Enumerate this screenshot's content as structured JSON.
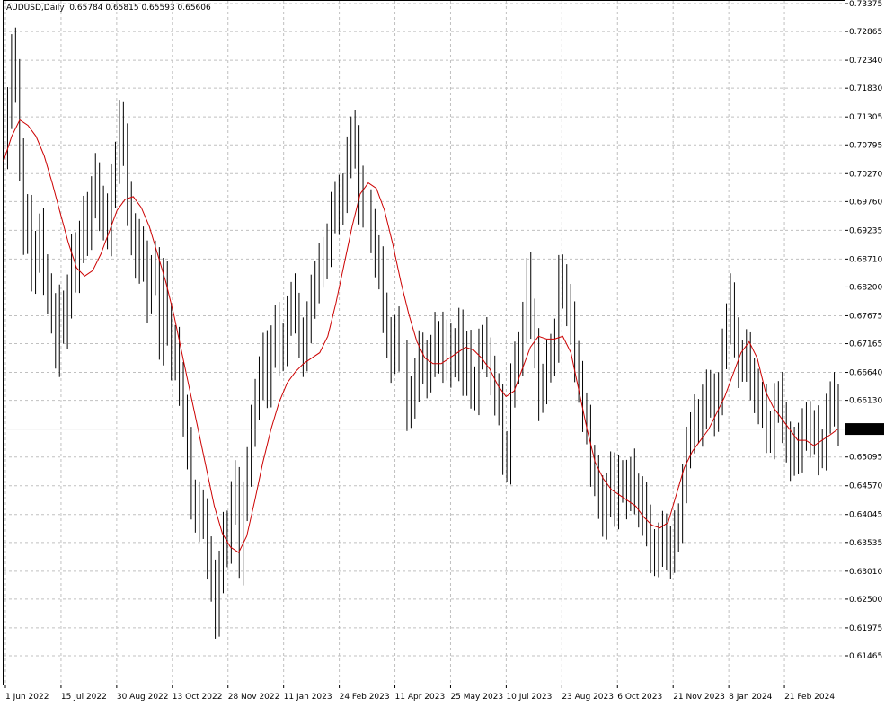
{
  "header": {
    "symbol": "AUDUSD,Daily",
    "ohlc": "0.65784 0.65815 0.65593 0.65606"
  },
  "colors": {
    "background": "#ffffff",
    "bars": "#000000",
    "moving_average": "#cc0000",
    "grid": "#c0c0c0",
    "current_price_line": "#c0c0c0",
    "price_tag_bg": "#000000",
    "price_tag_text": "#ffffff"
  },
  "chart_data": {
    "type": "line",
    "grid": true,
    "ylim": [
      0.61465,
      0.73375
    ],
    "y_ticks": [
      "0.73375",
      "0.72865",
      "0.72340",
      "0.71830",
      "0.71305",
      "0.70795",
      "0.70270",
      "0.69760",
      "0.69235",
      "0.68710",
      "0.68200",
      "0.67675",
      "0.67165",
      "0.66640",
      "0.66130",
      "0.65095",
      "0.64570",
      "0.64045",
      "0.63535",
      "0.63010",
      "0.62500",
      "0.61975",
      "0.61465"
    ],
    "x_ticks": [
      "1 Jun 2022",
      "15 Jul 2022",
      "30 Aug 2022",
      "13 Oct 2022",
      "28 Nov 2022",
      "11 Jan 2023",
      "24 Feb 2023",
      "11 Apr 2023",
      "25 May 2023",
      "10 Jul 2023",
      "23 Aug 2023",
      "6 Oct 2023",
      "21 Nov 2023",
      "8 Jan 2024",
      "21 Feb 2024"
    ],
    "current_price": 0.65606,
    "current_price_label": "0.65606",
    "series": [
      {
        "kind": "price_bars",
        "values": [
          0.708,
          0.714,
          0.725,
          0.72,
          0.705,
          0.692,
          0.695,
          0.685,
          0.688,
          0.692,
          0.685,
          0.68,
          0.678,
          0.67,
          0.678,
          0.675,
          0.68,
          0.688,
          0.685,
          0.69,
          0.695,
          0.692,
          0.699,
          0.702,
          0.695,
          0.696,
          0.692,
          0.7,
          0.705,
          0.712,
          0.708,
          0.697,
          0.692,
          0.687,
          0.69,
          0.686,
          0.68,
          0.685,
          0.686,
          0.672,
          0.683,
          0.675,
          0.669,
          0.671,
          0.664,
          0.659,
          0.652,
          0.644,
          0.64,
          0.642,
          0.639,
          0.633,
          0.628,
          0.622,
          0.63,
          0.637,
          0.635,
          0.643,
          0.646,
          0.632,
          0.642,
          0.65,
          0.656,
          0.662,
          0.665,
          0.67,
          0.664,
          0.671,
          0.675,
          0.67,
          0.672,
          0.676,
          0.68,
          0.678,
          0.672,
          0.67,
          0.676,
          0.68,
          0.683,
          0.686,
          0.687,
          0.69,
          0.695,
          0.698,
          0.696,
          0.7,
          0.705,
          0.71,
          0.708,
          0.697,
          0.7,
          0.696,
          0.692,
          0.688,
          0.685,
          0.678,
          0.672,
          0.669,
          0.674,
          0.671,
          0.668,
          0.66,
          0.662,
          0.665,
          0.67,
          0.668,
          0.666,
          0.67,
          0.673,
          0.669,
          0.673,
          0.668,
          0.671,
          0.669,
          0.674,
          0.666,
          0.67,
          0.664,
          0.663,
          0.67,
          0.672,
          0.67,
          0.665,
          0.663,
          0.66,
          0.652,
          0.65,
          0.664,
          0.668,
          0.67,
          0.675,
          0.684,
          0.677,
          0.67,
          0.662,
          0.665,
          0.668,
          0.67,
          0.672,
          0.684,
          0.682,
          0.679,
          0.675,
          0.669,
          0.664,
          0.66,
          0.656,
          0.65,
          0.647,
          0.644,
          0.64,
          0.644,
          0.648,
          0.642,
          0.647,
          0.646,
          0.644,
          0.648,
          0.645,
          0.641,
          0.643,
          0.638,
          0.634,
          0.633,
          0.635,
          0.637,
          0.634,
          0.633,
          0.638,
          0.638,
          0.647,
          0.652,
          0.656,
          0.658,
          0.657,
          0.66,
          0.663,
          0.662,
          0.659,
          0.663,
          0.67,
          0.676,
          0.68,
          0.672,
          0.668,
          0.669,
          0.67,
          0.665,
          0.663,
          0.661,
          0.66,
          0.656,
          0.655,
          0.66,
          0.662,
          0.658,
          0.653,
          0.651,
          0.653,
          0.652,
          0.656,
          0.657,
          0.655,
          0.656,
          0.652,
          0.653,
          0.658,
          0.662,
          0.661,
          0.6561
        ]
      },
      {
        "kind": "moving_average",
        "values": [
          0.705,
          0.7095,
          0.7125,
          0.7115,
          0.7095,
          0.706,
          0.701,
          0.6955,
          0.69,
          0.6855,
          0.684,
          0.685,
          0.688,
          0.692,
          0.696,
          0.698,
          0.6985,
          0.6965,
          0.693,
          0.688,
          0.683,
          0.677,
          0.67,
          0.663,
          0.656,
          0.649,
          0.642,
          0.637,
          0.6345,
          0.6335,
          0.6365,
          0.643,
          0.65,
          0.656,
          0.661,
          0.6645,
          0.6665,
          0.668,
          0.669,
          0.67,
          0.673,
          0.679,
          0.686,
          0.693,
          0.699,
          0.701,
          0.7,
          0.696,
          0.69,
          0.683,
          0.677,
          0.672,
          0.669,
          0.668,
          0.668,
          0.669,
          0.67,
          0.671,
          0.6705,
          0.669,
          0.667,
          0.664,
          0.662,
          0.663,
          0.667,
          0.671,
          0.673,
          0.6725,
          0.6725,
          0.673,
          0.67,
          0.663,
          0.656,
          0.65,
          0.647,
          0.645,
          0.644,
          0.643,
          0.642,
          0.64,
          0.6385,
          0.638,
          0.639,
          0.644,
          0.649,
          0.652,
          0.654,
          0.656,
          0.659,
          0.662,
          0.666,
          0.67,
          0.672,
          0.669,
          0.663,
          0.66,
          0.658,
          0.656,
          0.654,
          0.654,
          0.653,
          0.654,
          0.655,
          0.6561
        ]
      }
    ]
  }
}
